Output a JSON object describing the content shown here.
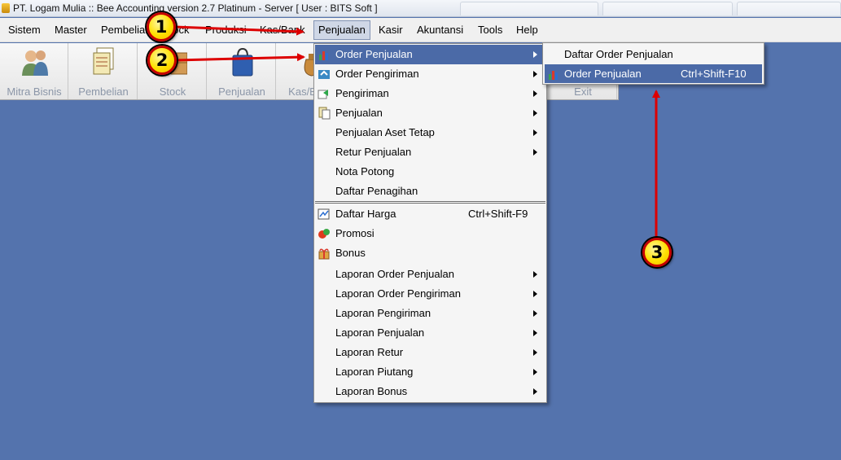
{
  "window": {
    "title": "PT. Logam Mulia :: Bee Accounting version 2.7 Platinum - Server  [ User : BITS Soft ]"
  },
  "menubar": [
    {
      "label": "Sistem"
    },
    {
      "label": "Master"
    },
    {
      "label": "Pembelian"
    },
    {
      "label": "Stock"
    },
    {
      "label": "Produksi"
    },
    {
      "label": "Kas/Bank"
    },
    {
      "label": "Penjualan"
    },
    {
      "label": "Kasir"
    },
    {
      "label": "Akuntansi"
    },
    {
      "label": "Tools"
    },
    {
      "label": "Help"
    }
  ],
  "toolbar": [
    {
      "label": "Mitra Bisnis",
      "icon": "users-icon"
    },
    {
      "label": "Pembelian",
      "icon": "documents-icon"
    },
    {
      "label": "Stock",
      "icon": "box-icon"
    },
    {
      "label": "Penjualan",
      "icon": "shopping-bag-icon"
    },
    {
      "label": "Kas/Bank",
      "icon": "money-bag-icon"
    },
    {
      "label": "Exit",
      "icon": "exit-icon"
    }
  ],
  "penjualan_menu": [
    {
      "label": "Order Penjualan",
      "submenu": true,
      "icon": "chart-icon",
      "highlighted": true
    },
    {
      "label": "Order Pengiriman",
      "submenu": true,
      "icon": "truck-icon"
    },
    {
      "label": "Pengiriman",
      "submenu": true,
      "icon": "forward-icon"
    },
    {
      "label": "Penjualan",
      "submenu": true,
      "icon": "receipt-icon"
    },
    {
      "label": "Penjualan Aset Tetap",
      "submenu": true
    },
    {
      "label": "Retur Penjualan",
      "submenu": true
    },
    {
      "label": "Nota Potong"
    },
    {
      "label": "Daftar Penagihan"
    },
    {
      "label": "Daftar Harga",
      "shortcut": "Ctrl+Shift-F9",
      "icon": "price-list-icon"
    },
    {
      "label": "Promosi",
      "icon": "promo-icon"
    },
    {
      "label": "Bonus",
      "icon": "gift-icon"
    },
    {
      "label": "Laporan Order Penjualan",
      "submenu": true
    },
    {
      "label": "Laporan Order Pengiriman",
      "submenu": true
    },
    {
      "label": "Laporan Pengiriman",
      "submenu": true
    },
    {
      "label": "Laporan Penjualan",
      "submenu": true
    },
    {
      "label": "Laporan Retur",
      "submenu": true
    },
    {
      "label": "Laporan Piutang",
      "submenu": true
    },
    {
      "label": "Laporan Bonus",
      "submenu": true
    }
  ],
  "order_penjualan_submenu": [
    {
      "label": "Daftar Order Penjualan"
    },
    {
      "label": "Order Penjualan",
      "shortcut": "Ctrl+Shift-F10",
      "icon": "chart-icon",
      "highlighted": true
    }
  ],
  "annotations": [
    {
      "number": "1"
    },
    {
      "number": "2"
    },
    {
      "number": "3"
    }
  ],
  "colors": {
    "desktop": "#5473ad",
    "highlight": "#4b6aa7",
    "arrow": "#dd0000",
    "badge": "#ffe000"
  }
}
